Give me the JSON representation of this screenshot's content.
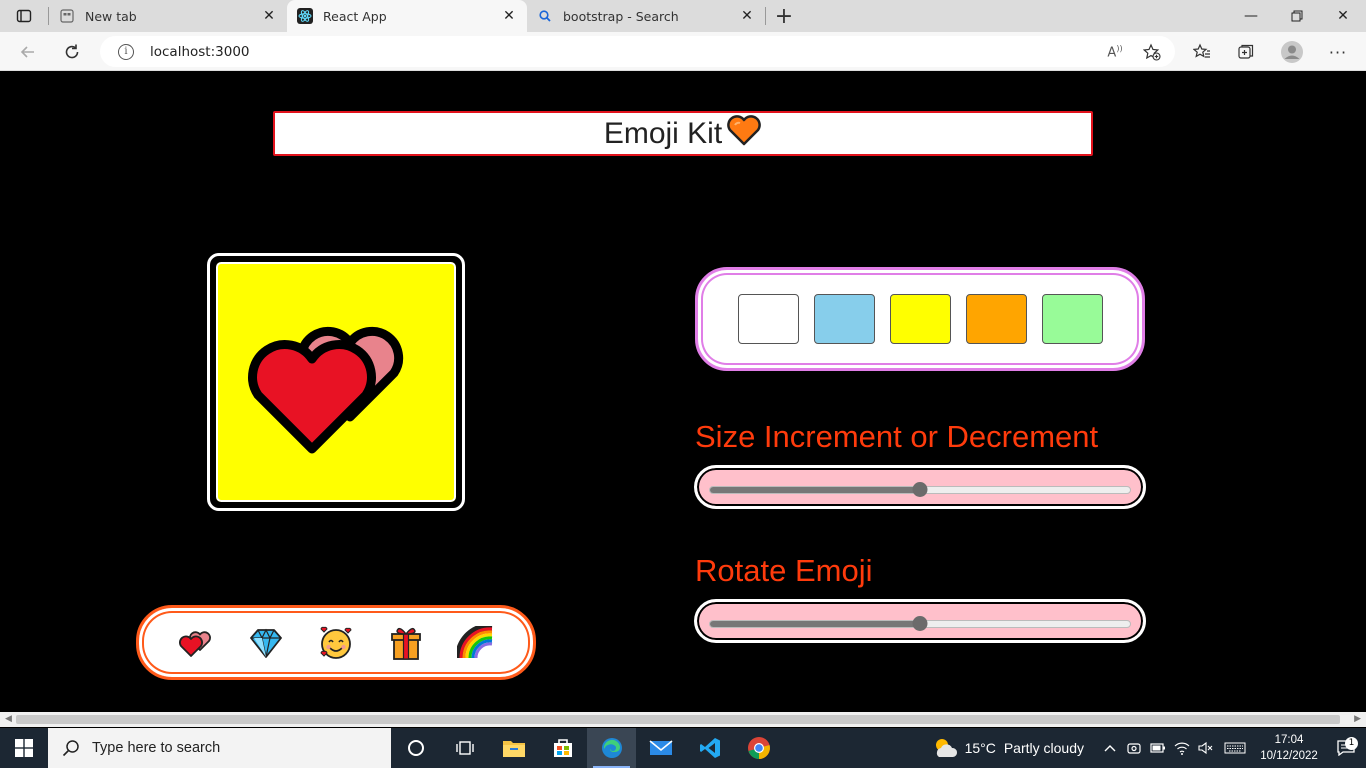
{
  "browser": {
    "tabs": [
      {
        "title": "New tab",
        "active": false,
        "favicon": "newtab-icon"
      },
      {
        "title": "React App",
        "active": true,
        "favicon": "react-icon"
      },
      {
        "title": "bootstrap - Search",
        "active": false,
        "favicon": "search-icon"
      }
    ],
    "url": "localhost:3000"
  },
  "app": {
    "title": "Emoji Kit",
    "palette_colors": [
      "#ffffff",
      "#87ceeb",
      "#ffff00",
      "#ffa500",
      "#98fb98"
    ],
    "preview_background": "#ffff00",
    "size_label": "Size Increment or Decrement",
    "size_value": 0.5,
    "rotate_label": "Rotate Emoji",
    "rotate_value": 0.5,
    "emoji_options": [
      "two-hearts-icon",
      "gem-icon",
      "smiling-face-with-hearts-icon",
      "gift-icon",
      "rainbow-icon"
    ]
  },
  "taskbar": {
    "search_placeholder": "Type here to search",
    "weather_temp": "15°C",
    "weather_condition": "Partly cloudy",
    "time": "17:04",
    "date": "10/12/2022",
    "notification_count": "1"
  }
}
